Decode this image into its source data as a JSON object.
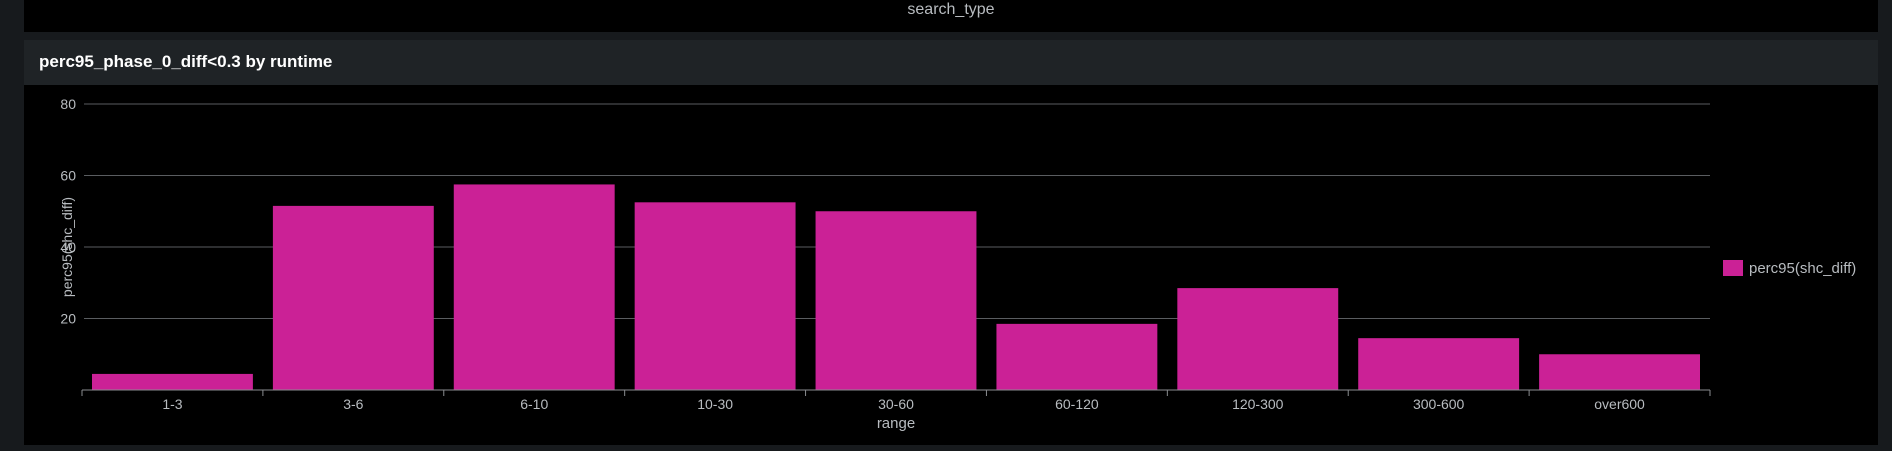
{
  "top_panel": {
    "axis_label": "search_type"
  },
  "panel": {
    "title": "perc95_phase_0_diff<0.3 by runtime"
  },
  "chart_data": {
    "type": "bar",
    "categories": [
      "1-3",
      "3-6",
      "6-10",
      "10-30",
      "30-60",
      "60-120",
      "120-300",
      "300-600",
      "over600"
    ],
    "series": [
      {
        "name": "perc95(shc_diff)",
        "values": [
          4.5,
          51.5,
          57.5,
          52.5,
          50.0,
          18.5,
          28.5,
          14.5,
          10.0
        ],
        "color": "#cb2196"
      }
    ],
    "xlabel": "range",
    "ylabel": "perc95(shc_diff)",
    "ylim": [
      0,
      80
    ],
    "yticks": [
      20,
      40,
      60,
      80
    ],
    "grid": true,
    "legend_position": "right"
  },
  "colors": {
    "background": "#000000",
    "page_background": "#171a1d",
    "header_background": "#1f2326",
    "gridline": "#5a5d60",
    "axis_text": "#b8bcc0",
    "title_text": "#ffffff",
    "bar": "#cb2196"
  }
}
